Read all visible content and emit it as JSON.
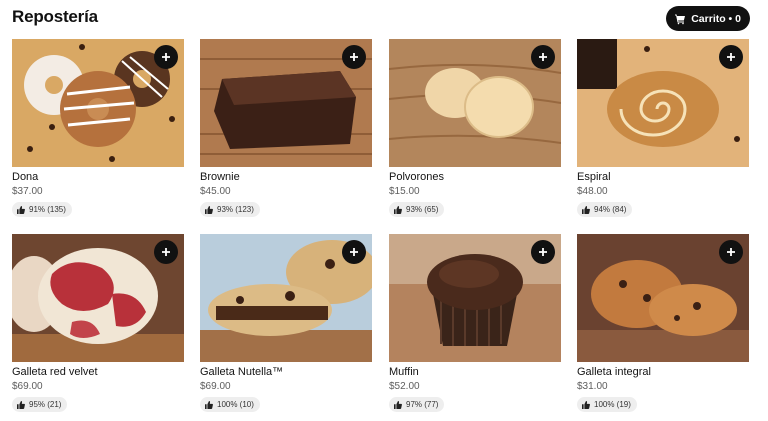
{
  "header": {
    "title": "Repostería",
    "cart_label": "Carrito • 0"
  },
  "products": [
    {
      "name": "Dona",
      "price": "$37.00",
      "rating": "91% (135)"
    },
    {
      "name": "Brownie",
      "price": "$45.00",
      "rating": "93% (123)"
    },
    {
      "name": "Polvorones",
      "price": "$15.00",
      "rating": "93% (65)"
    },
    {
      "name": "Espiral",
      "price": "$48.00",
      "rating": "94% (84)"
    },
    {
      "name": "Galleta red velvet",
      "price": "$69.00",
      "rating": "95% (21)"
    },
    {
      "name": "Galleta Nutella™",
      "price": "$69.00",
      "rating": "100% (10)"
    },
    {
      "name": "Muffin",
      "price": "$52.00",
      "rating": "97% (77)"
    },
    {
      "name": "Galleta integral",
      "price": "$31.00",
      "rating": "100% (19)"
    }
  ],
  "icons": {
    "cart": "cart-icon",
    "add": "plus-icon",
    "rating": "thumbs-up-icon"
  },
  "colors": {
    "button_bg": "#111111",
    "badge_bg": "#eeeeee",
    "price_text": "#5e5e5e"
  }
}
